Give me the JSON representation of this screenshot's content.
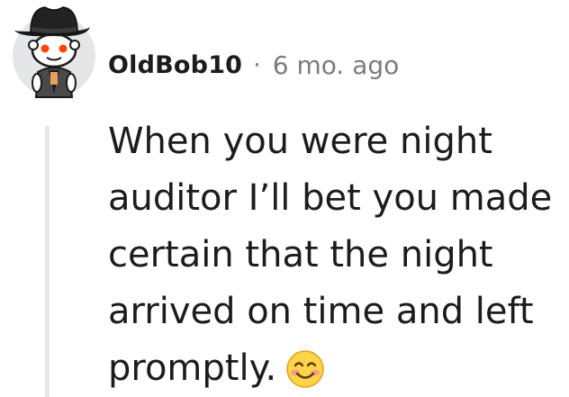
{
  "comment": {
    "author": "OldBob10",
    "separator": "·",
    "timestamp": "6 mo. ago",
    "body": "When you were night auditor I’ll bet you made certain that the night arrived on time and left promptly.",
    "emoji_icon": "smiling-face-with-smiling-eyes-icon",
    "avatar_icon": "snoo-cowboy-hat-avatar-icon"
  },
  "colors": {
    "text": "#1c1c1c",
    "meta": "#7c7c7c",
    "thread_line": "#e6e6e6",
    "avatar_bg": "#e4e6e8",
    "emoji_yellow": "#fcd44a",
    "emoji_blush": "#f6938b"
  }
}
